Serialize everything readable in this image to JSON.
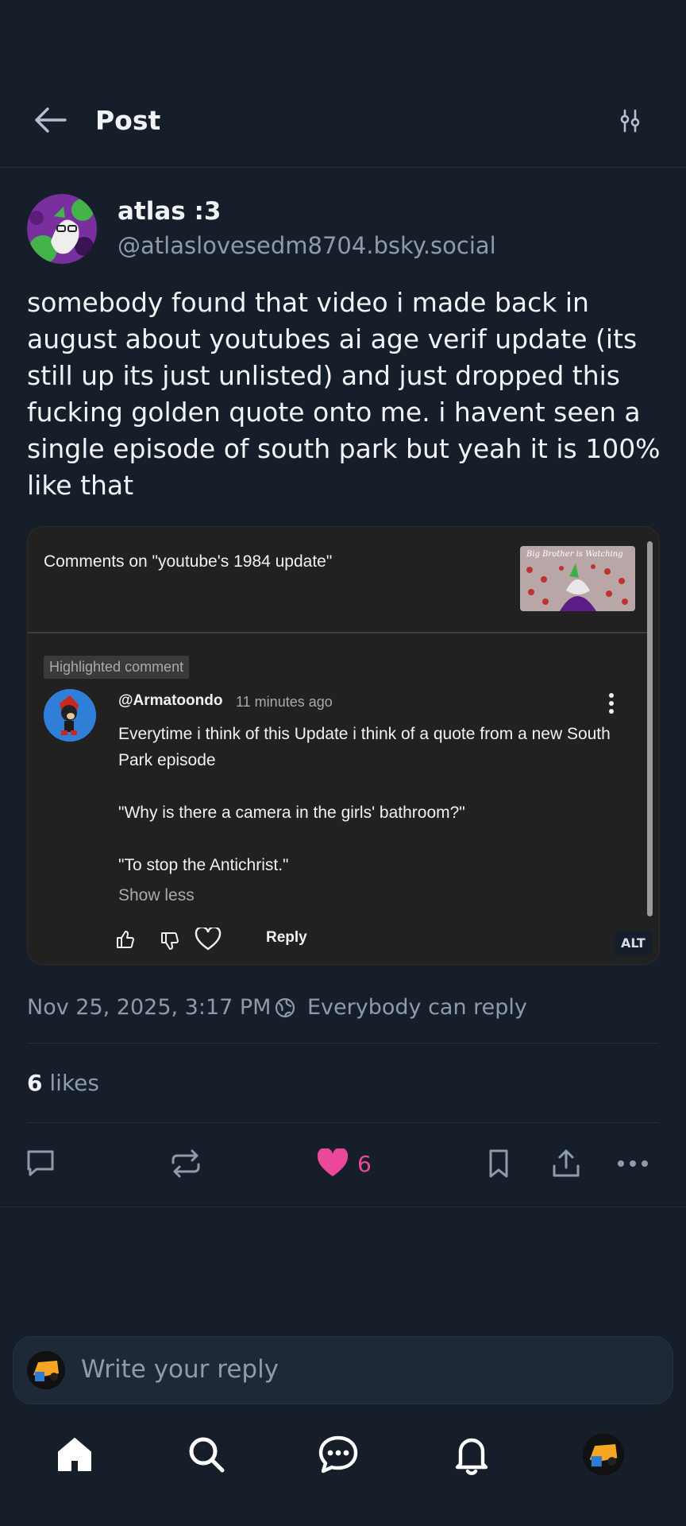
{
  "header": {
    "title": "Post"
  },
  "post": {
    "author": {
      "display_name": "atlas :3",
      "handle": "@atlaslovesedm8704.bsky.social"
    },
    "text": "somebody found that video i made back in august about youtubes ai age verif update (its still up its just unlisted) and just dropped this fucking golden quote onto me. i havent seen a single episode of south park but yeah it is 100% like that",
    "embed": {
      "heading": "Comments on \"youtube's 1984 update\"",
      "thumbnail_text": "Big Brother is Watching",
      "highlight_label": "Highlighted comment",
      "comment": {
        "author": "@Armatoondo",
        "time": "11 minutes ago",
        "lines": [
          "Everytime i think of this Update i think of a quote from a new South Park episode",
          "",
          "\"Why is there a camera in the girls' bathroom?\"",
          "",
          "\"To stop the Antichrist.\""
        ],
        "show_less": "Show less",
        "reply_label": "Reply"
      },
      "alt_badge": "ALT"
    },
    "timestamp": "Nov 25, 2025, 3:17 PM",
    "reply_setting": "Everybody can reply",
    "likes_count": "6",
    "likes_label": " likes",
    "like_action_count": "6"
  },
  "reply_bar": {
    "placeholder": "Write your reply"
  },
  "colors": {
    "background": "#161e2a",
    "muted": "#8f9bab",
    "like": "#ec4899"
  },
  "nav": [
    "home-icon",
    "search-icon",
    "chat-icon",
    "bell-icon",
    "profile-avatar"
  ]
}
